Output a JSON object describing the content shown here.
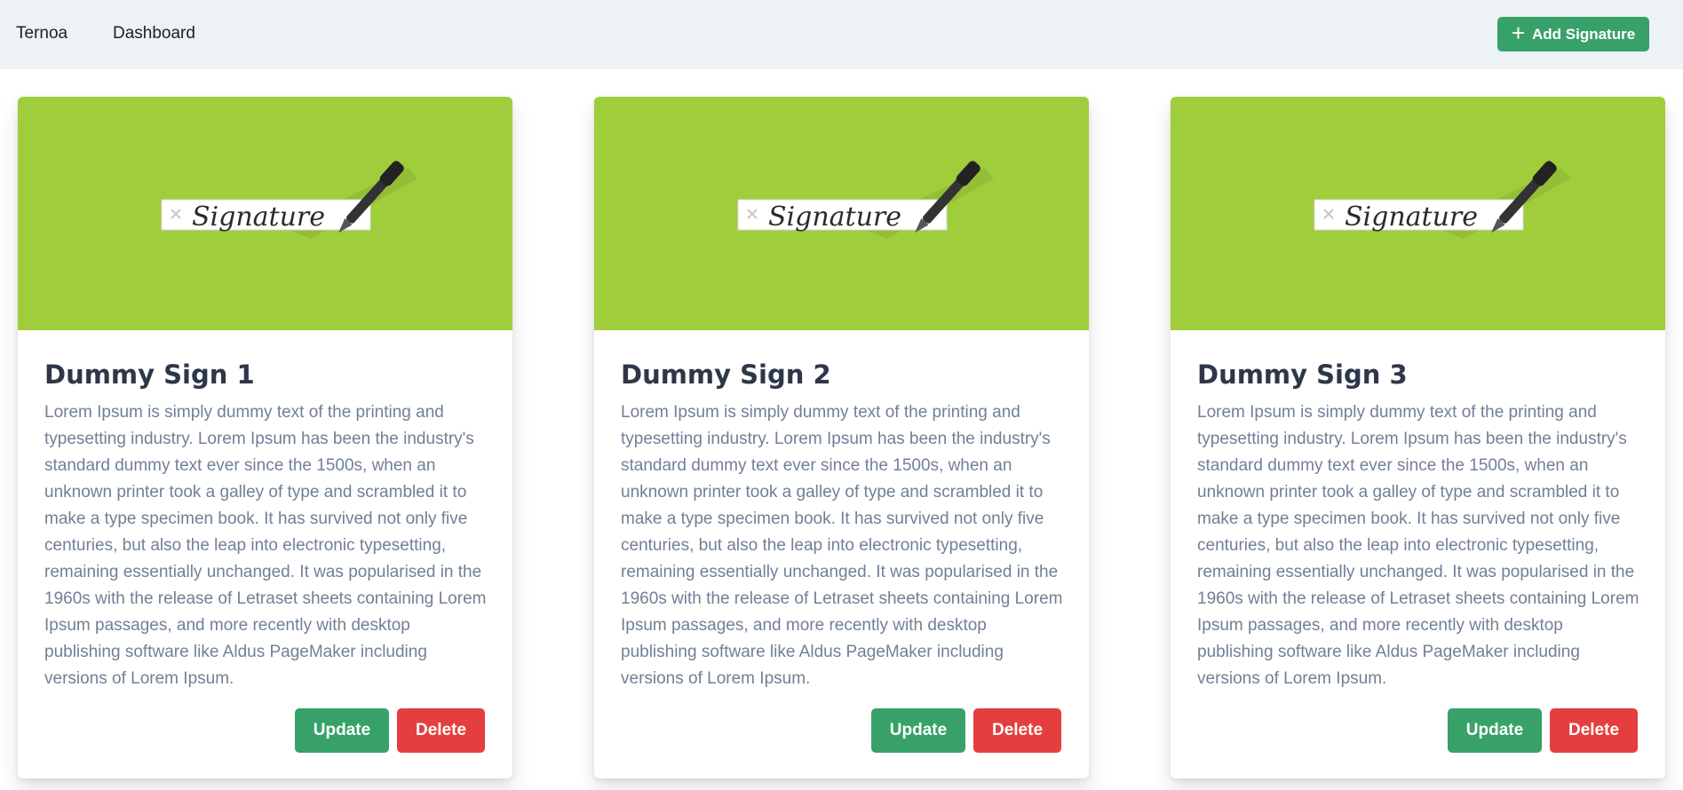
{
  "navbar": {
    "brand": "Ternoa",
    "dashboard": "Dashboard",
    "add_button_label": "Add Signature"
  },
  "cards": [
    {
      "title": "Dummy Sign 1",
      "image_text": "Signature",
      "description": "Lorem Ipsum is simply dummy text of the printing and typesetting industry. Lorem Ipsum has been the industry's standard dummy text ever since the 1500s, when an unknown printer took a galley of type and scrambled it to make a type specimen book. It has survived not only five centuries, but also the leap into electronic typesetting, remaining essentially unchanged. It was popularised in the 1960s with the release of Letraset sheets containing Lorem Ipsum passages, and more recently with desktop publishing software like Aldus PageMaker including versions of Lorem Ipsum.",
      "update_label": "Update",
      "delete_label": "Delete"
    },
    {
      "title": "Dummy Sign 2",
      "image_text": "Signature",
      "description": "Lorem Ipsum is simply dummy text of the printing and typesetting industry. Lorem Ipsum has been the industry's standard dummy text ever since the 1500s, when an unknown printer took a galley of type and scrambled it to make a type specimen book. It has survived not only five centuries, but also the leap into electronic typesetting, remaining essentially unchanged. It was popularised in the 1960s with the release of Letraset sheets containing Lorem Ipsum passages, and more recently with desktop publishing software like Aldus PageMaker including versions of Lorem Ipsum.",
      "update_label": "Update",
      "delete_label": "Delete"
    },
    {
      "title": "Dummy Sign 3",
      "image_text": "Signature",
      "description": "Lorem Ipsum is simply dummy text of the printing and typesetting industry. Lorem Ipsum has been the industry's standard dummy text ever since the 1500s, when an unknown printer took a galley of type and scrambled it to make a type specimen book. It has survived not only five centuries, but also the leap into electronic typesetting, remaining essentially unchanged. It was popularised in the 1960s with the release of Letraset sheets containing Lorem Ipsum passages, and more recently with desktop publishing software like Aldus PageMaker including versions of Lorem Ipsum.",
      "update_label": "Update",
      "delete_label": "Delete"
    }
  ],
  "colors": {
    "navbar_bg": "#edf2f7",
    "primary_green": "#38a169",
    "danger_red": "#e53e3e",
    "image_bg": "#a0cd3c",
    "title_text": "#2d3748",
    "body_text": "#718096"
  },
  "icons": {
    "add": "plus-icon",
    "image": "signature-pen-image"
  }
}
